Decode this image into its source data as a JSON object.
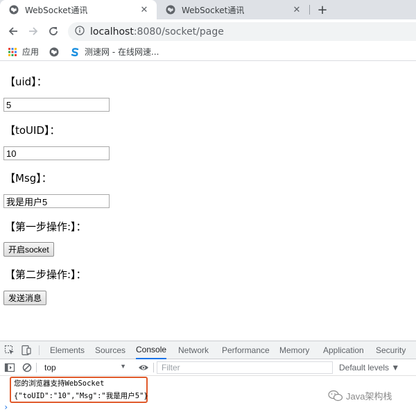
{
  "browser": {
    "tabs": [
      {
        "title": "WebSocket通讯",
        "active": true,
        "close_glyph": "✕"
      },
      {
        "title": "WebSocket通讯",
        "active": false,
        "close_glyph": "✕"
      }
    ],
    "new_tab_glyph": "+",
    "address": {
      "host": "localhost",
      "path": ":8080/socket/page"
    },
    "bookmarks": [
      {
        "label": "应用",
        "icon": "apps-grid-icon"
      },
      {
        "label": "",
        "icon": "globe-icon"
      },
      {
        "label": "测速网 - 在线网速...",
        "icon": "speedtest-s-icon"
      }
    ]
  },
  "page": {
    "uid_label": "【uid】：",
    "uid_value": "5",
    "touid_label": "【toUID】：",
    "touid_value": "10",
    "msg_label": "【Msg】：",
    "msg_value": "我是用户5",
    "step1_label": "【第一步操作:】：",
    "open_socket_button": "开启socket",
    "step2_label": "【第二步操作:】：",
    "send_button": "发送消息"
  },
  "devtools": {
    "tabs": [
      "Elements",
      "Sources",
      "Console",
      "Network",
      "Performance",
      "Memory",
      "Application",
      "Security"
    ],
    "active_tab": "Console",
    "context": "top",
    "filter_placeholder": "Filter",
    "levels": "Default levels ▼",
    "console_lines": [
      "您的浏览器支持WebSocket",
      "{\"toUID\":\"10\",\"Msg\":\"我是用户5\"}"
    ],
    "prompt": "›",
    "highlight_color": "#e05a2b"
  },
  "watermark": {
    "text": "Java架构栈",
    "icon": "wechat-icon"
  },
  "colors": {
    "tab_strip": "#dee1e6",
    "omnibox": "#f1f3f4",
    "accent": "#1a73e8"
  }
}
